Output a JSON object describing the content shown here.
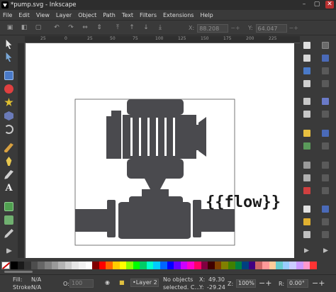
{
  "window": {
    "title": "*pump.svg - Inkscape",
    "controls": {
      "minimize": "–",
      "maximize": "▢",
      "close": "✕"
    }
  },
  "menu": [
    "File",
    "Edit",
    "View",
    "Layer",
    "Object",
    "Path",
    "Text",
    "Filters",
    "Extensions",
    "Help"
  ],
  "tool_controls": {
    "x_label": "X:",
    "x_value": "88.208",
    "y_label": "Y:",
    "y_value": "64.047",
    "pm": "−+"
  },
  "ruler_ticks": [
    "25",
    "0",
    "25",
    "50",
    "75",
    "100",
    "125",
    "150",
    "175",
    "200",
    "225"
  ],
  "canvas_text": "{{flow}}",
  "palette_colors": [
    "#000000",
    "#1a1a1a",
    "#333333",
    "#4d4d4d",
    "#666666",
    "#808080",
    "#999999",
    "#b3b3b3",
    "#cccccc",
    "#e6e6e6",
    "#f2f2f2",
    "#ffffff",
    "#800000",
    "#ff0000",
    "#ff6600",
    "#ffcc00",
    "#ffff00",
    "#88ff00",
    "#00ff00",
    "#00cc66",
    "#00ffcc",
    "#00ccff",
    "#0066ff",
    "#0000ff",
    "#6600ff",
    "#cc00ff",
    "#ff00cc",
    "#ff0066",
    "#800040",
    "#400000",
    "#804000",
    "#808000",
    "#408000",
    "#008040",
    "#004080",
    "#400080",
    "#cc6666",
    "#ff9999",
    "#ffcc99",
    "#66cccc",
    "#99ccff",
    "#ccccff",
    "#cc99ff",
    "#ff99cc",
    "#ff3333"
  ],
  "status": {
    "fill_label": "Fill:",
    "fill_value": "N/A",
    "stroke_label": "Stroke:",
    "stroke_value": "N/A",
    "opacity_label": "O:",
    "opacity_value": "100",
    "layer": "•Layer 2",
    "message_line1": "No objects",
    "message_line2": "selected. C...",
    "x_label": "X:",
    "x_value": "49.30",
    "y_label": "Y:",
    "y_value": "-29.24",
    "zoom_label": "Z:",
    "zoom_value": "100%",
    "rotate_label": "R:",
    "rotate_value": "0.00°"
  }
}
